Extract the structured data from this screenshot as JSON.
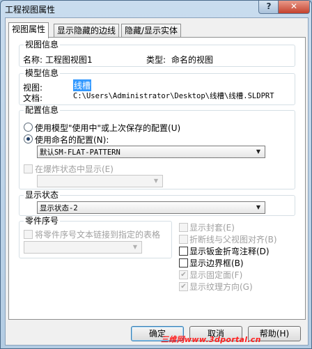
{
  "window": {
    "title": "工程视图属性",
    "help_glyph": "?",
    "close_glyph": "✕"
  },
  "tabs": [
    "视图属性",
    "显示隐藏的边线",
    "隐藏/显示实体"
  ],
  "view_info": {
    "legend": "视图信息",
    "name_label": "名称:",
    "name_value": "工程图视图1",
    "type_label": "类型:",
    "type_value": "命名的视图"
  },
  "model_info": {
    "legend": "模型信息",
    "view_label": "视图:",
    "view_value": "线槽",
    "doc_label": "文档:",
    "doc_value": "C:\\Users\\Administrator\\Desktop\\线槽\\线槽.SLDPRT"
  },
  "config_info": {
    "legend": "配置信息",
    "radio_in_use": "使用模型\"使用中\"或上次保存的配置(U)",
    "radio_named": "使用命名的配置(N):",
    "named_config_value": "默认SM-FLAT-PATTERN",
    "exploded_label": "在爆炸状态中显示(E)",
    "exploded_combo_value": ""
  },
  "display_state": {
    "legend": "显示状态",
    "value": "显示状态-2"
  },
  "balloon": {
    "legend": "零件序号",
    "link_label": "将零件序号文本链接到指定的表格",
    "combo_value": ""
  },
  "options": [
    {
      "label": "显示封套(E)",
      "enabled": false,
      "checked": false
    },
    {
      "label": "折断线与父视图对齐(B)",
      "enabled": false,
      "checked": false
    },
    {
      "label": "显示钣金折弯注释(D)",
      "enabled": true,
      "checked": false
    },
    {
      "label": "显示边界框(B)",
      "enabled": true,
      "checked": false
    },
    {
      "label": "显示固定面(F)",
      "enabled": false,
      "checked": true
    },
    {
      "label": "显示纹理方向(G)",
      "enabled": false,
      "checked": true
    }
  ],
  "buttons": {
    "ok": "确定",
    "cancel": "取消",
    "help": "帮助(H)"
  },
  "watermark": "三维网www.3dportal.cn",
  "colors": {
    "selection": "#3399ff",
    "close": "#c4422e"
  }
}
